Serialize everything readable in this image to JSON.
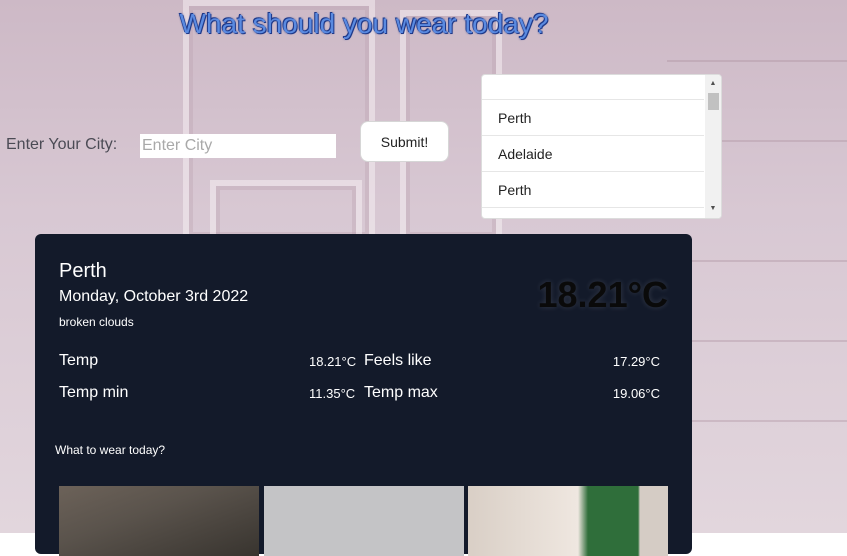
{
  "header": {
    "title": "What should you wear today?"
  },
  "search": {
    "label": "Enter Your City:",
    "placeholder": "Enter City",
    "value": "",
    "submit_label": "Submit!"
  },
  "history": {
    "items": [
      "",
      "Perth",
      "Adelaide",
      "Perth"
    ]
  },
  "weather": {
    "city": "Perth",
    "date": "Monday, October 3rd 2022",
    "description": "broken clouds",
    "current_temp": "18.21°C",
    "rows": [
      {
        "label1": "Temp",
        "value1": "18.21°C",
        "label2": "Feels like",
        "value2": "17.29°C"
      },
      {
        "label1": "Temp min",
        "value1": "11.35°C",
        "label2": "Temp max",
        "value2": "19.06°C"
      }
    ],
    "wear_heading": "What to wear today?"
  },
  "colors": {
    "card_bg": "#131a2a",
    "title": "#5a8ae0"
  },
  "icons": {
    "scroll_up": "scroll-up-arrow-icon",
    "scroll_down": "scroll-down-arrow-icon"
  }
}
